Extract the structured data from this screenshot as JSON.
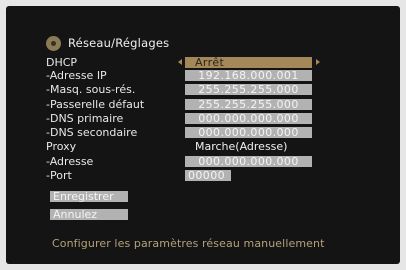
{
  "header": {
    "title": "Réseau/Réglages",
    "icon": "gear-icon"
  },
  "rows": [
    {
      "label": "DHCP",
      "value": "Arrêt"
    },
    {
      "label": "-Adresse IP",
      "value": "192.168.000.001"
    },
    {
      "label": "-Masq. sous-rés.",
      "value": "255.255.255.000"
    },
    {
      "label": "-Passerelle défaut",
      "value": "255.255.255.000"
    },
    {
      "label": "-DNS primaire",
      "value": "000.000.000.000"
    },
    {
      "label": "-DNS secondaire",
      "value": "000.000.000.000"
    },
    {
      "label": "Proxy",
      "value": "Marche(Adresse)"
    },
    {
      "label": "-Adresse",
      "value": "000.000.000.000"
    },
    {
      "label": "-Port",
      "value": "00000"
    }
  ],
  "buttons": {
    "save": "Enregistrer",
    "cancel": "Annulez"
  },
  "footer": {
    "hint": "Configurer les paramètres réseau manuellement"
  },
  "colors": {
    "background": "#141414",
    "field": "#b2b2b2",
    "selected_field": "#a4885a",
    "hint_text": "#b5a07a"
  }
}
